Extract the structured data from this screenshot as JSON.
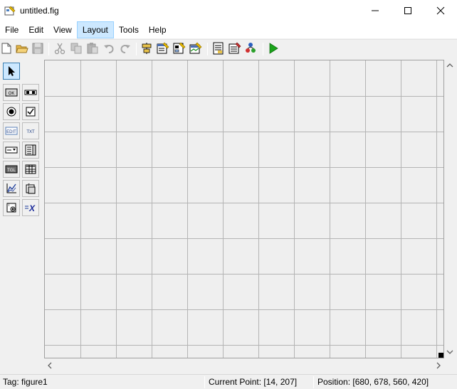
{
  "window": {
    "title": "untitled.fig",
    "app_icon": "guide-figure-icon",
    "controls": [
      "minimize-icon",
      "maximize-icon",
      "close-icon"
    ]
  },
  "menubar": {
    "items": [
      {
        "label": "File"
      },
      {
        "label": "Edit"
      },
      {
        "label": "View"
      },
      {
        "label": "Layout",
        "active": true
      },
      {
        "label": "Tools"
      },
      {
        "label": "Help"
      }
    ]
  },
  "toolbar": {
    "buttons": [
      {
        "icon": "new-file-icon",
        "enabled": true
      },
      {
        "icon": "open-folder-icon",
        "enabled": true
      },
      {
        "icon": "save-icon",
        "enabled": false
      },
      {
        "icon": "cut-icon",
        "enabled": false
      },
      {
        "icon": "copy-icon",
        "enabled": false
      },
      {
        "icon": "paste-icon",
        "enabled": false
      },
      {
        "icon": "undo-icon",
        "enabled": false
      },
      {
        "icon": "redo-icon",
        "enabled": false
      },
      {
        "icon": "align-objects-icon",
        "enabled": true
      },
      {
        "icon": "menu-editor-icon",
        "enabled": true
      },
      {
        "icon": "tab-order-editor-icon",
        "enabled": true
      },
      {
        "icon": "toolbar-editor-icon",
        "enabled": true
      },
      {
        "icon": "editor-icon",
        "enabled": true
      },
      {
        "icon": "property-inspector-icon",
        "enabled": true
      },
      {
        "icon": "object-browser-icon",
        "enabled": true
      },
      {
        "icon": "run-figure-icon",
        "enabled": true
      }
    ]
  },
  "palette": {
    "tools": [
      {
        "icon": "select-pointer-icon",
        "label": "",
        "selected": true
      },
      {
        "icon": "push-button-icon",
        "label": "OK"
      },
      {
        "icon": "slider-icon",
        "label": ""
      },
      {
        "icon": "radio-button-icon",
        "label": ""
      },
      {
        "icon": "check-box-icon",
        "label": ""
      },
      {
        "icon": "edit-text-icon",
        "label": "EDIT"
      },
      {
        "icon": "static-text-icon",
        "label": "TXT"
      },
      {
        "icon": "popup-menu-icon",
        "label": ""
      },
      {
        "icon": "listbox-icon",
        "label": ""
      },
      {
        "icon": "toggle-button-icon",
        "label": "TGL"
      },
      {
        "icon": "table-icon",
        "label": ""
      },
      {
        "icon": "axes-icon",
        "label": ""
      },
      {
        "icon": "panel-icon",
        "label": ""
      },
      {
        "icon": "button-group-icon",
        "label": ""
      },
      {
        "icon": "activex-control-icon",
        "label": "X"
      }
    ]
  },
  "statusbar": {
    "tag": "Tag: figure1",
    "current_point": "Current Point:  [14, 207]",
    "position": "Position: [680, 678, 560, 420]"
  },
  "colors": {
    "canvas_bg": "#efefef",
    "grid_line": "#b4b4b4",
    "selection": "#cce8ff",
    "run_green": "#1aa31a"
  }
}
